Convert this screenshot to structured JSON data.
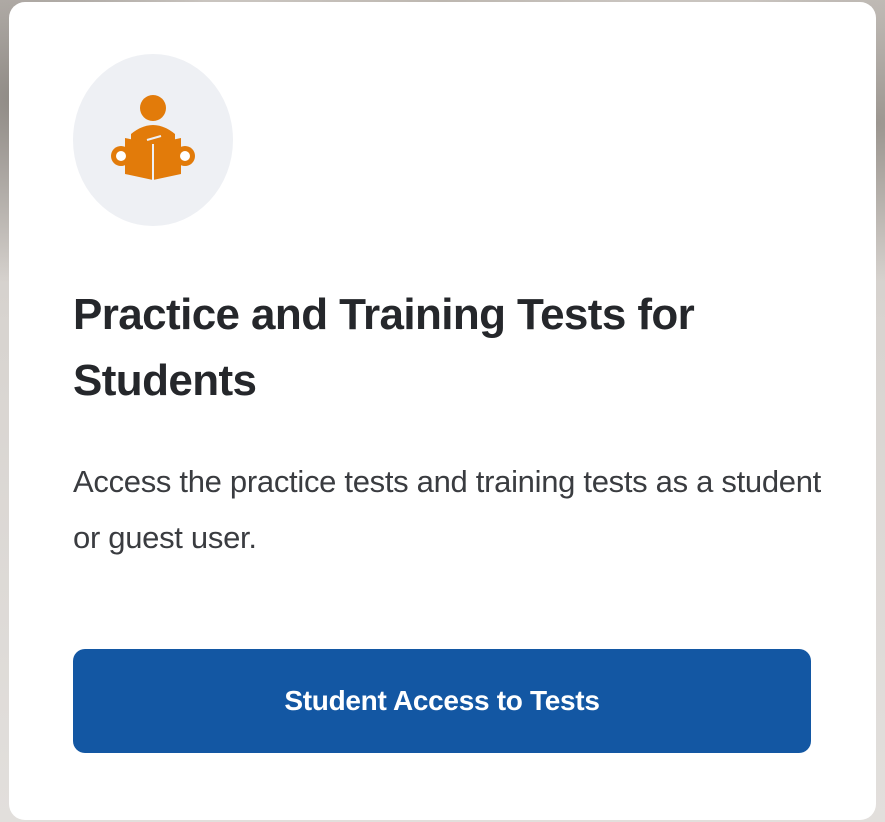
{
  "card": {
    "icon": "student-reading-icon",
    "icon_color": "#e27b0a",
    "title": "Practice and Training Tests for Students",
    "description": "Access the practice tests and training tests as a student or guest user.",
    "button_label": "Student Access to Tests",
    "button_color": "#1357a3"
  }
}
